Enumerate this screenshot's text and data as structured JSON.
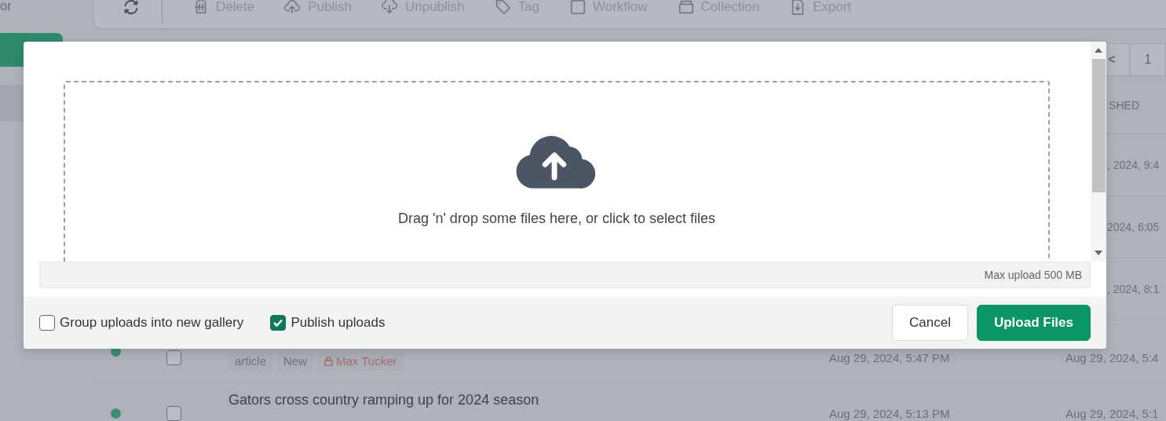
{
  "sidebar": {
    "text": "or"
  },
  "toolbar": {
    "actions": [
      {
        "label": "Delete"
      },
      {
        "label": "Publish"
      },
      {
        "label": "Unpublish"
      },
      {
        "label": "Tag"
      },
      {
        "label": "Workflow"
      },
      {
        "label": "Collection"
      },
      {
        "label": "Export"
      }
    ]
  },
  "table": {
    "pagination": {
      "prev": "<",
      "page": "1"
    },
    "header": "SHED",
    "rows": [
      {
        "updated": ", 2024, 9:4"
      },
      {
        "updated": "2024, 6:05"
      },
      {
        "updated": ", 2024, 8:1"
      },
      {
        "checked": false,
        "tags": [
          "article",
          "New"
        ],
        "author": "Max Tucker",
        "created": "Aug 29, 2024, 5:47 PM",
        "updated": "Aug 29, 2024, 5:4"
      },
      {
        "checked": false,
        "title": "Gators cross country ramping up for 2024 season",
        "created": "Aug 29, 2024, 5:13 PM",
        "updated": "Aug 29, 2024, 5:1"
      }
    ]
  },
  "modal": {
    "dropzone": {
      "text": "Drag 'n' drop some files here, or click to select files"
    },
    "limit": "Max upload 500 MB",
    "options": [
      {
        "label": "Group uploads into new gallery",
        "checked": false
      },
      {
        "label": "Publish uploads",
        "checked": true
      }
    ],
    "buttons": [
      {
        "label": "Cancel",
        "kind": "secondary"
      },
      {
        "label": "Upload Files",
        "kind": "primary"
      }
    ]
  }
}
